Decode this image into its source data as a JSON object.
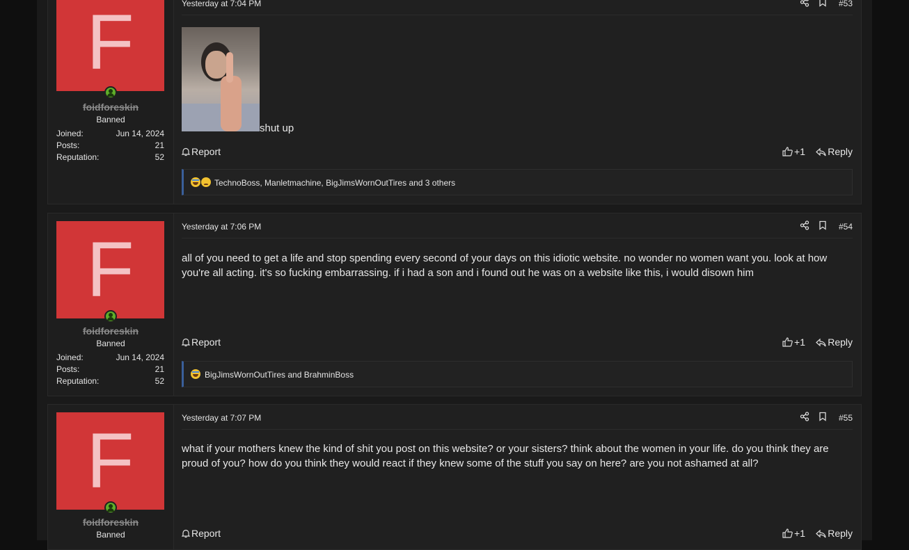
{
  "posts": [
    {
      "avatar_letter": "F",
      "username": "foidforeskin",
      "user_title": "Banned",
      "stats": [
        {
          "label": "Joined:",
          "value": "Jun 14, 2024"
        },
        {
          "label": "Posts:",
          "value": "21"
        },
        {
          "label": "Reputation:",
          "value": "52"
        }
      ],
      "date": "Yesterday at 7:04 PM",
      "number": "#53",
      "text": "shut up",
      "report_label": "Report",
      "like_label": "+1",
      "reply_label": "Reply",
      "reactions": "TechnoBoss, Manletmachine, BigJimsWornOutTires and 3 others"
    },
    {
      "avatar_letter": "F",
      "username": "foidforeskin",
      "user_title": "Banned",
      "stats": [
        {
          "label": "Joined:",
          "value": "Jun 14, 2024"
        },
        {
          "label": "Posts:",
          "value": "21"
        },
        {
          "label": "Reputation:",
          "value": "52"
        }
      ],
      "date": "Yesterday at 7:06 PM",
      "number": "#54",
      "text": "all of you need to get a life and stop spending every second of your days on this idiotic website. no wonder no women want you. look at how you're all acting. it's so fucking embarrassing. if i had a son and i found out he was on a website like this, i would disown him",
      "report_label": "Report",
      "like_label": "+1",
      "reply_label": "Reply",
      "reactions": "BigJimsWornOutTires and BrahminBoss"
    },
    {
      "avatar_letter": "F",
      "username": "foidforeskin",
      "user_title": "Banned",
      "date": "Yesterday at 7:07 PM",
      "number": "#55",
      "text": "what if your mothers knew the kind of shit you post on this website? or your sisters? think about the women in your life. do you think they are proud of you? how do you think they would react if they knew some of the stuff you say on here? are you not ashamed at all?",
      "report_label": "Report",
      "like_label": "+1",
      "reply_label": "Reply"
    }
  ],
  "icons": {
    "share": "share-icon",
    "bookmark": "bookmark-icon",
    "report": "bell-icon",
    "like": "thumbs-up-icon",
    "reply": "reply-icon"
  },
  "colors": {
    "avatar_bg": "#d13637",
    "avatar_letter": "#f4c2c4",
    "online": "#5fae2a",
    "reaction_accent": "#3a5f9a"
  }
}
